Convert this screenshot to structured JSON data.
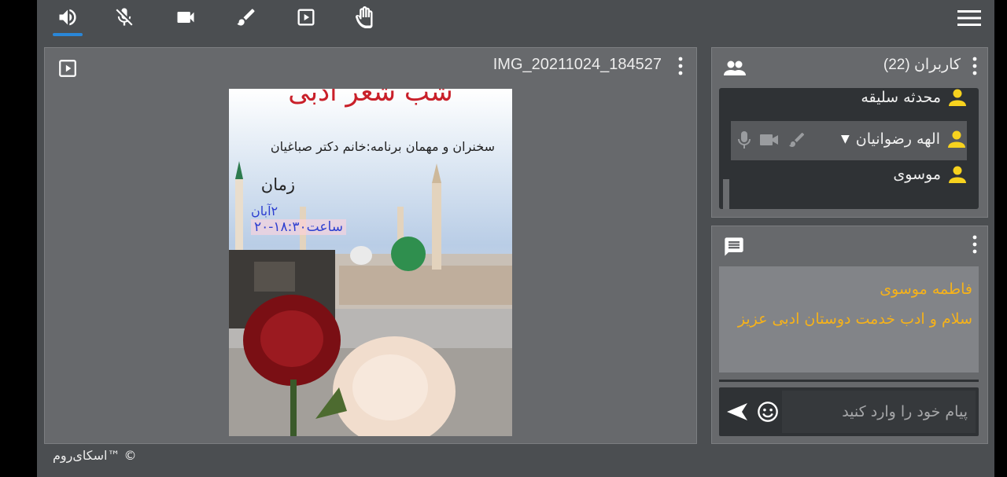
{
  "toolbar": {
    "buttons": [
      "speaker-icon",
      "mic-muted-icon",
      "camera-icon",
      "brush-icon",
      "play-box-icon",
      "hand-icon",
      "menu-icon"
    ]
  },
  "main": {
    "title": "IMG_20211024_184527",
    "poster": {
      "heading": "شب شعر ادبی",
      "line1": "سخنران و مهمان برنامه:خانم دکتر صباغیان",
      "line2": "زمان",
      "line3": "۲آبان",
      "line4": "ساعت۱۸:۳۰-۲۰"
    }
  },
  "users": {
    "title": "کاربران (22)",
    "list": [
      {
        "name": "محدثه سلیقه"
      },
      {
        "name": "الهه رضوانیان"
      },
      {
        "name": "موسوی"
      }
    ]
  },
  "chat": {
    "sender": "فاطمه موسوی",
    "message": "سلام و ادب خدمت دوستان ادبی عزیز",
    "placeholder": "پیام خود را وارد کنید"
  },
  "footer": {
    "copyright": "© ™اسکای‌روم"
  },
  "colors": {
    "accent": "#2a87d8",
    "chat_text": "#f6b21a",
    "user_icon": "#f7d21e"
  }
}
